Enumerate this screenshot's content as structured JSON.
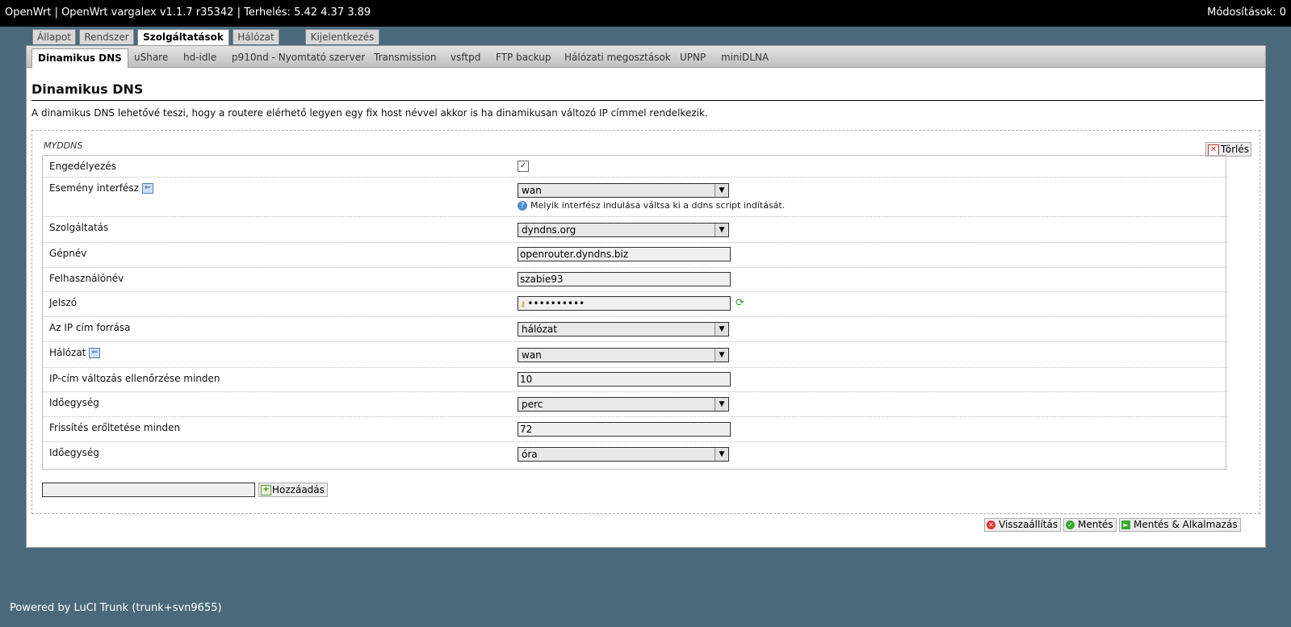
{
  "topbar": {
    "title": "OpenWrt | OpenWrt vargalex v1.1.7 r35342 | Terhelés: 5.42 4.37 3.89",
    "changes": "Módosítások: 0"
  },
  "main_tabs": [
    {
      "label": "Állapot",
      "active": false
    },
    {
      "label": "Rendszer",
      "active": false
    },
    {
      "label": "Szolgáltatások",
      "active": true
    },
    {
      "label": "Hálózat",
      "active": false
    },
    {
      "label": "Kijelentkezés",
      "active": false
    }
  ],
  "sub_tabs": [
    {
      "label": "Dinamikus DNS",
      "active": true
    },
    {
      "label": "uShare"
    },
    {
      "label": "hd-idle"
    },
    {
      "label": "p910nd - Nyomtató szerver"
    },
    {
      "label": "Transmission"
    },
    {
      "label": "vsftpd"
    },
    {
      "label": "FTP backup"
    },
    {
      "label": "Hálózati megosztások"
    },
    {
      "label": "UPNP"
    },
    {
      "label": "miniDLNA"
    }
  ],
  "page": {
    "title": "Dinamikus DNS",
    "description": "A dinamikus DNS lehetővé teszi, hogy a routere elérhető legyen egy fix host névvel akkor is ha dinamikusan változó IP címmel rendelkezik."
  },
  "section": {
    "legend": "MYDDNS",
    "delete_label": "Törlés",
    "fields": [
      {
        "label": "Engedélyezés",
        "type": "checkbox",
        "checked": true,
        "check_glyph": "✓"
      },
      {
        "label": "Esemény interfész",
        "type": "select",
        "value": "wan",
        "has_ref": true,
        "help": "Melyik interfész indulása váltsa ki a ddns script indítását."
      },
      {
        "label": "Szolgáltatás",
        "type": "select",
        "value": "dyndns.org"
      },
      {
        "label": "Gépnév",
        "type": "text",
        "value": "openrouter.dyndns.biz"
      },
      {
        "label": "Felhasználónév",
        "type": "text",
        "value": "szabie93"
      },
      {
        "label": "Jelszó",
        "type": "password",
        "value": "••••••••••"
      },
      {
        "label": "Az IP cím forrása",
        "type": "select",
        "value": "hálózat"
      },
      {
        "label": "Hálózat",
        "type": "select",
        "value": "wan",
        "has_ref": true
      },
      {
        "label": "IP-cím változás ellenőrzése minden",
        "type": "text",
        "value": "10"
      },
      {
        "label": "Időegység",
        "type": "select",
        "value": "perc"
      },
      {
        "label": "Frissítés erőltetése minden",
        "type": "text",
        "value": "72"
      },
      {
        "label": "Időegység",
        "type": "select",
        "value": "óra"
      }
    ]
  },
  "add": {
    "input_value": "",
    "button_label": "Hozzáadás"
  },
  "buttons": {
    "reset_label": "Visszaállítás",
    "save_label": "Mentés",
    "save_apply_label": "Mentés & Alkalmazás"
  },
  "footer": {
    "text": "Powered by LuCI Trunk (trunk+svn9655)"
  },
  "colors": {
    "background": "#4a6a7c",
    "topbar": "#000000",
    "panel": "#ffffff"
  }
}
